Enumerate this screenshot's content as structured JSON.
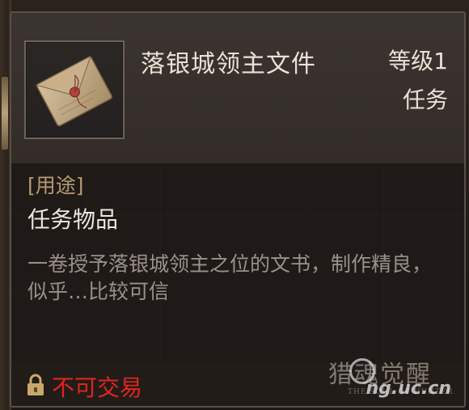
{
  "item": {
    "name": "落银城领主文件",
    "level": "等级1",
    "type": "任务",
    "icon": "sealed-envelope-icon"
  },
  "usage": {
    "label": "[用途]",
    "value": "任务物品"
  },
  "description": "一卷授予落银城领主之位的文书，制作精良，似乎…比较可信",
  "footer": {
    "trade_status": "不可交易",
    "trade_icon": "lock-icon",
    "status_color": "#e0251f"
  },
  "logo": {
    "title": "猎魂觉醒",
    "subtitle": "THE SOUL OF HUNTER"
  },
  "watermark": "ng.uc.cn"
}
